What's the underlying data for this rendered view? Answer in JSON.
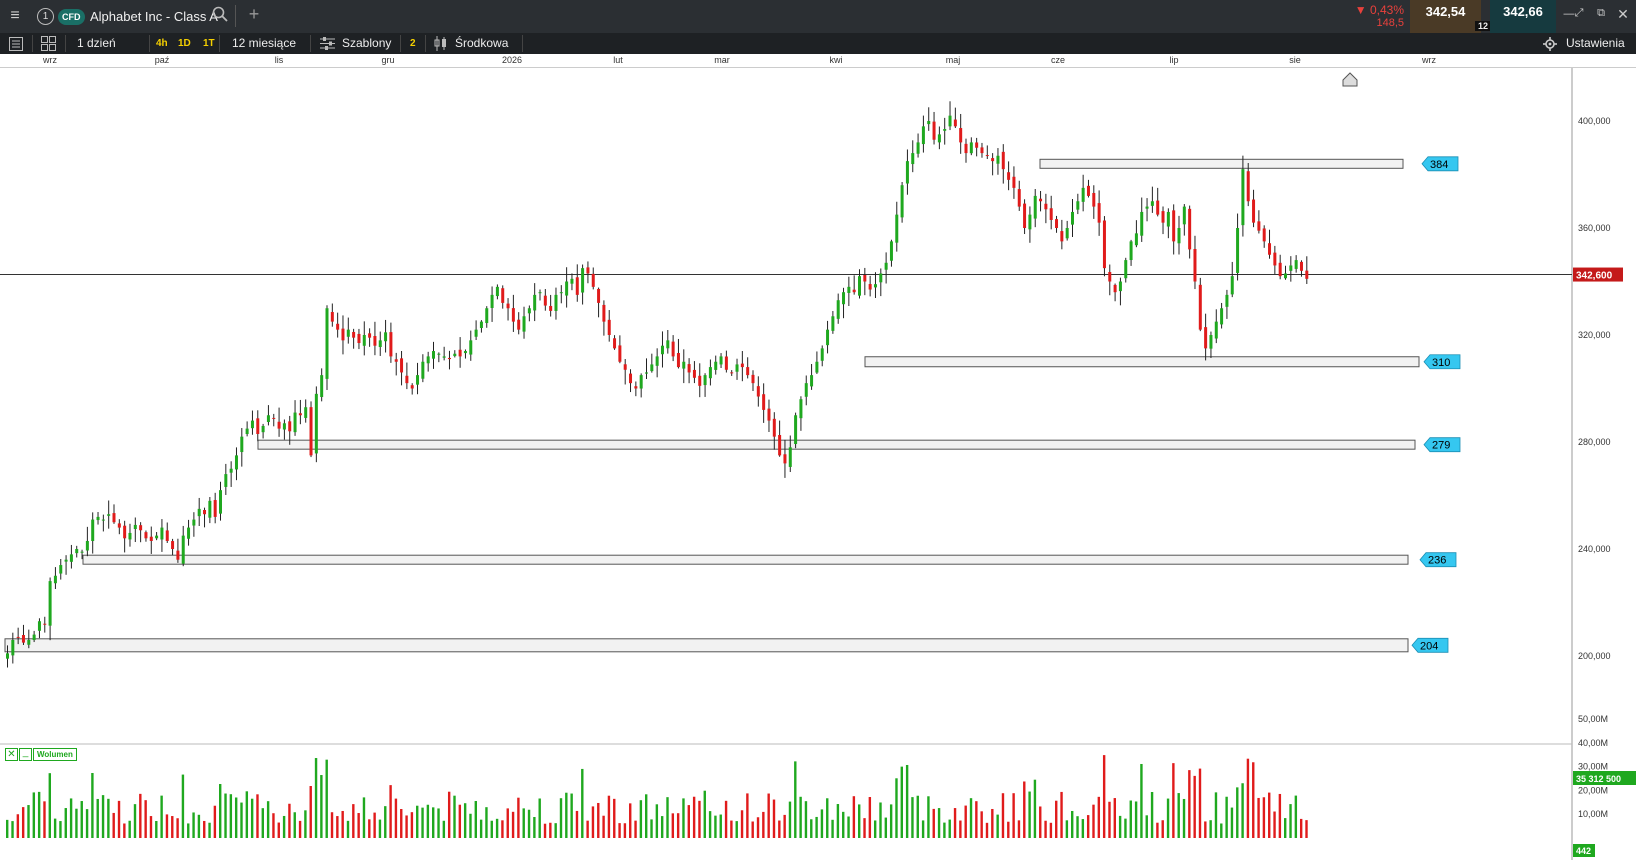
{
  "window": {
    "tab_number": "1",
    "instrument_badge": "CFD",
    "instrument_name": "Alphabet Inc - Class A",
    "change_pct": "▼ 0,43%",
    "change_abs": "148,5",
    "bid": "342,54",
    "ask": "342,66",
    "spread": "12"
  },
  "toolbar": {
    "period": "1 dzień",
    "interval_4h": "4h",
    "interval_1d": "1D",
    "interval_1t": "1T",
    "range": "12 miesiące",
    "templates": "Szablony",
    "templates_count": "2",
    "price_type": "Środkowa",
    "settings": "Ustawienia"
  },
  "dates": [
    "wrz",
    "paź",
    "lis",
    "gru",
    "2026",
    "lut",
    "mar",
    "kwi",
    "maj",
    "cze",
    "lip",
    "sie",
    "wrz"
  ],
  "price_axis": [
    "400,000",
    "360,000",
    "320,000",
    "280,000",
    "240,000",
    "200,000"
  ],
  "current_price_label": "342,600",
  "volume_axis": [
    "50,00M",
    "40,00M",
    "30,00M",
    "20,00M",
    "10,00M"
  ],
  "volume_panel_label": "Wolumen",
  "volume_current": "35 312 500",
  "volume_bottom_tag": "442",
  "levels": [
    {
      "label": "384",
      "price": 384
    },
    {
      "label": "310",
      "price": 310
    },
    {
      "label": "279",
      "price": 279
    },
    {
      "label": "236",
      "price": 236
    },
    {
      "label": "204",
      "price": 204
    }
  ],
  "colors": {
    "up": "#1fa81f",
    "down": "#e01b1b",
    "level_tag": "#35c7f0",
    "price_tag": "#c41a1a",
    "volume_tag": "#1fa81f"
  },
  "chart_data": {
    "type": "candlestick",
    "y_range": [
      190,
      410
    ],
    "volume_range_millions": [
      0,
      50
    ],
    "closes": [
      201,
      206,
      207,
      205,
      206,
      208,
      213,
      212,
      228,
      230,
      234,
      236,
      238,
      240,
      239,
      243,
      251,
      252,
      251,
      253,
      250,
      248,
      244,
      246,
      249,
      247,
      244,
      243,
      245,
      248,
      243,
      240,
      236,
      245,
      248,
      251,
      255,
      253,
      258,
      252,
      262,
      268,
      270,
      275,
      282,
      285,
      288,
      283,
      286,
      290,
      289,
      285,
      287,
      284,
      291,
      290,
      293,
      275,
      298,
      305,
      330,
      325,
      322,
      318,
      322,
      319,
      317,
      320,
      319,
      316,
      318,
      321,
      312,
      310,
      306,
      302,
      300,
      305,
      310,
      312,
      314,
      313,
      312,
      311,
      313,
      312,
      314,
      318,
      322,
      325,
      330,
      335,
      338,
      332,
      330,
      325,
      322,
      327,
      330,
      335,
      336,
      331,
      329,
      335,
      336,
      340,
      341,
      335,
      345,
      343,
      338,
      332,
      325,
      320,
      315,
      310,
      307,
      302,
      300,
      305,
      306,
      309,
      312,
      316,
      318,
      312,
      308,
      310,
      306,
      304,
      301,
      305,
      308,
      310,
      312,
      307,
      306,
      309,
      308,
      305,
      302,
      297,
      292,
      288,
      282,
      275,
      272,
      278,
      290,
      296,
      302,
      305,
      310,
      315,
      322,
      327,
      333,
      336,
      338,
      336,
      342,
      340,
      337,
      339,
      343,
      347,
      355,
      365,
      376,
      385,
      388,
      392,
      398,
      400,
      393,
      395,
      397,
      402,
      398,
      392,
      388,
      392,
      390,
      388,
      387,
      385,
      387,
      382,
      378,
      375,
      368,
      360,
      365,
      372,
      370,
      367,
      363,
      360,
      355,
      360,
      366,
      370,
      375,
      372,
      368,
      362,
      345,
      340,
      336,
      340,
      348,
      355,
      358,
      366,
      368,
      370,
      365,
      362,
      366,
      355,
      360,
      368,
      352,
      340,
      322,
      315,
      320,
      325,
      330,
      335,
      342,
      360,
      382,
      370,
      362,
      359,
      355,
      350,
      346,
      342,
      343,
      346,
      348,
      344,
      341
    ]
  }
}
